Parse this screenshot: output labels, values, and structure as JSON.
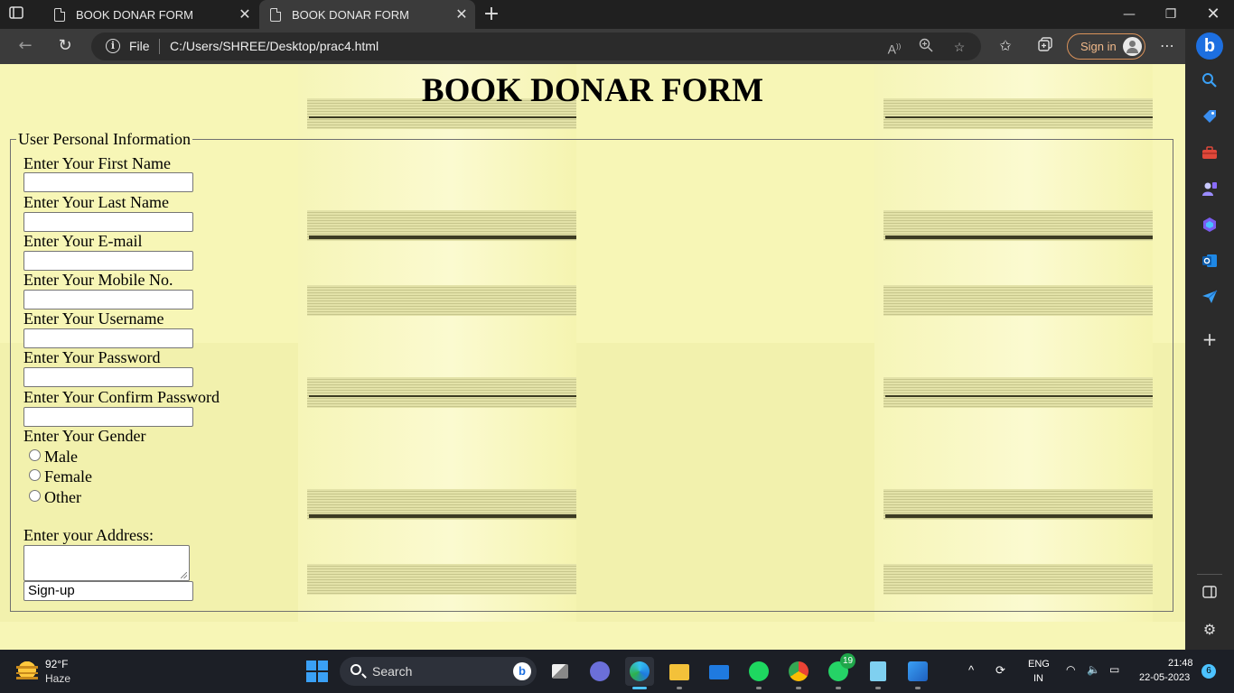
{
  "browser": {
    "tabs": [
      {
        "title": "BOOK DONAR FORM",
        "active": false
      },
      {
        "title": "BOOK DONAR FORM",
        "active": true
      }
    ],
    "site_label": "File",
    "url": "C:/Users/SHREE/Desktop/prac4.html",
    "signin_label": "Sign in",
    "accent_color": "#1d6fe0"
  },
  "page": {
    "title": "BOOK DONAR FORM",
    "fieldset_legend": "User Personal Information",
    "fields": {
      "first_name": {
        "label": "Enter Your First Name",
        "value": ""
      },
      "last_name": {
        "label": "Enter Your Last Name",
        "value": ""
      },
      "email": {
        "label": "Enter Your E-mail",
        "value": ""
      },
      "mobile": {
        "label": "Enter Your Mobile No.",
        "value": ""
      },
      "username": {
        "label": "Enter Your Username",
        "value": ""
      },
      "password": {
        "label": "Enter Your Password",
        "value": ""
      },
      "confirm_password": {
        "label": "Enter Your Confirm Password",
        "value": ""
      }
    },
    "gender": {
      "label": "Enter Your Gender",
      "options": [
        "Male",
        "Female",
        "Other"
      ],
      "selected": null
    },
    "address": {
      "label": "Enter your Address:",
      "value": ""
    },
    "submit_label": "Sign-up",
    "background_color": "#f7f6b6"
  },
  "taskbar": {
    "weather_temp": "92°F",
    "weather_desc": "Haze",
    "search_label": "Search",
    "whatsapp_badge": "19",
    "language_line1": "ENG",
    "language_line2": "IN",
    "time": "21:48",
    "date": "22-05-2023",
    "notification_count": "6"
  }
}
